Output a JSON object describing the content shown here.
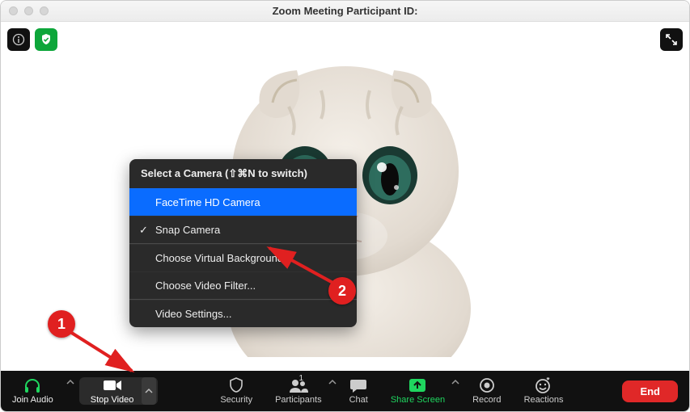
{
  "window": {
    "title": "Zoom Meeting Participant ID:"
  },
  "overlay": {
    "info_icon": "info",
    "shield_icon": "shield-check",
    "expand_icon": "expand"
  },
  "menu": {
    "header": "Select a Camera (⇧⌘N to switch)",
    "items": [
      {
        "label": "FaceTime HD Camera",
        "selected": true,
        "checked": false
      },
      {
        "label": "Snap Camera",
        "selected": false,
        "checked": true
      }
    ],
    "options": [
      "Choose Virtual Background...",
      "Choose Video Filter..."
    ],
    "settings": "Video Settings..."
  },
  "toolbar": {
    "join_audio": "Join Audio",
    "stop_video": "Stop Video",
    "security": "Security",
    "participants": "Participants",
    "participants_count": "1",
    "chat": "Chat",
    "share_screen": "Share Screen",
    "record": "Record",
    "reactions": "Reactions",
    "end": "End"
  },
  "annotations": {
    "step1": "1",
    "step2": "2"
  }
}
